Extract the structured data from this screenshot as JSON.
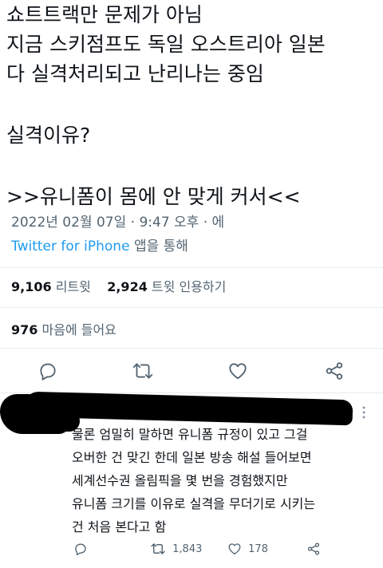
{
  "tweet": {
    "lines": [
      "쇼트트랙만 문제가 아님",
      "지금 스키점프도 독일 오스트리아 일본",
      "다 실격처리되고 난리나는 중임",
      "",
      "실격이유?",
      "",
      ">>유니폼이 몸에 안 맞게 커서<<"
    ],
    "timestamp": "2022년 02월 07일 · 9:47 오후 · 에",
    "source_app": "Twitter for iPhone",
    "source_suffix": " 앱을 통해"
  },
  "stats": {
    "retweets_count": "9,106",
    "retweets_label": "리트윗",
    "quotes_count": "2,924",
    "quotes_label": "트윗 인용하기",
    "likes_count": "976",
    "likes_label": "마음에 들어요"
  },
  "actions": {
    "icons": [
      "reply-icon",
      "retweet-icon",
      "like-icon",
      "share-icon"
    ],
    "icon_color": "#536471"
  },
  "reply": {
    "lines": [
      "물론 엄밀히 말하면 유니폼 규정이 있고 그걸",
      "오버한 건 맞긴 한데 일본 방송 해설 들어보면",
      "세계선수권 올림픽을 몇 번을 경험했지만",
      "유니폼 크기를 이유로 실격을 무더기로 시키는",
      "건 처음 본다고 함"
    ],
    "retweet_count": "1,843",
    "like_count": "178"
  },
  "colors": {
    "text": "#0f1419",
    "secondary": "#536471",
    "link": "#1d9bf0",
    "divider": "#e6ecf0"
  }
}
